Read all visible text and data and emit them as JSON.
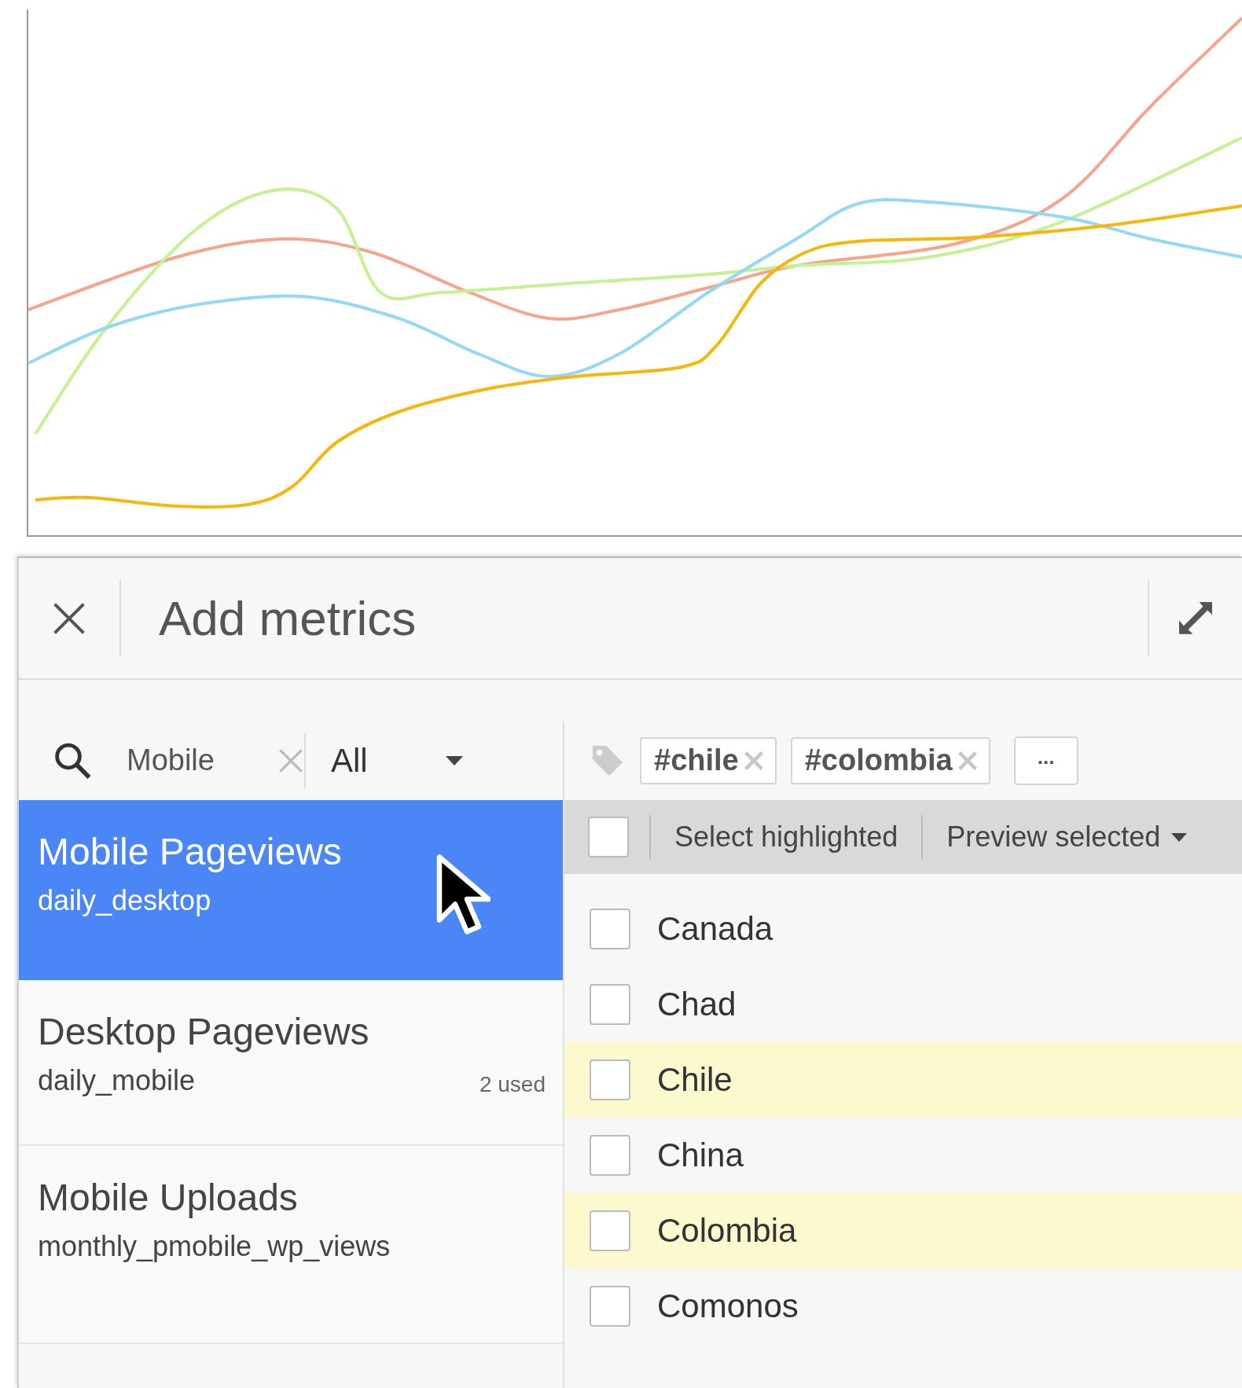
{
  "panel": {
    "title": "Add metrics"
  },
  "search": {
    "value": "Mobile"
  },
  "filter": {
    "value": "All"
  },
  "tags": [
    {
      "label": "#chile"
    },
    {
      "label": "#colombia"
    }
  ],
  "more_button": {
    "label": "..."
  },
  "metrics": [
    {
      "name": "Mobile Pageviews",
      "id": "daily_desktop",
      "selected": true
    },
    {
      "name": "Desktop Pageviews",
      "id": "daily_mobile",
      "usage": "2 used",
      "selected": false
    },
    {
      "name": "Mobile Uploads",
      "id": "monthly_pmobile_wp_views",
      "selected": false
    }
  ],
  "list_header": {
    "checked": false,
    "select_label": "Select highlighted",
    "preview_label": "Preview selected"
  },
  "countries": [
    {
      "name": "Canada",
      "checked": false,
      "highlighted": false
    },
    {
      "name": "Chad",
      "checked": false,
      "highlighted": false
    },
    {
      "name": "Chile",
      "checked": false,
      "highlighted": true
    },
    {
      "name": "China",
      "checked": false,
      "highlighted": false
    },
    {
      "name": "Colombia",
      "checked": false,
      "highlighted": true
    },
    {
      "name": "Comonos",
      "checked": false,
      "highlighted": false
    }
  ]
}
